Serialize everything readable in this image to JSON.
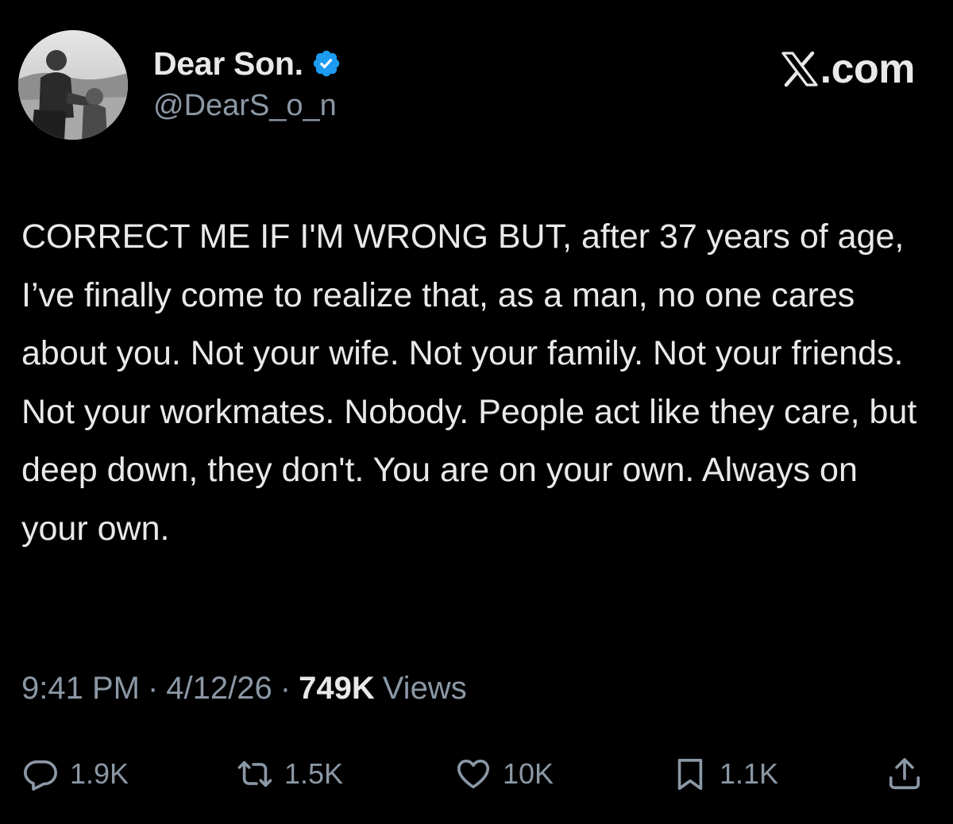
{
  "author": {
    "display_name": "Dear Son.",
    "handle": "@DearS_o_n",
    "verified": true,
    "avatar_icon": "avatar-photo"
  },
  "brand": {
    "logo_icon": "x-logo-icon",
    "text": ".com"
  },
  "tweet": {
    "text": "CORRECT ME IF I'M WRONG BUT, after 37 years of age, I’ve finally come to realize that, as a man, no one cares about you. Not your wife. Not your family. Not your friends. Not your workmates. Nobody. People act like they care, but deep down, they don't. You are on your own. Always on your own."
  },
  "meta": {
    "time": "9:41 PM",
    "date": "4/12/26",
    "separator": "·",
    "views_count": "749K",
    "views_label": "Views"
  },
  "actions": {
    "reply": {
      "icon": "reply-icon",
      "count": "1.9K"
    },
    "repost": {
      "icon": "repost-icon",
      "count": "1.5K"
    },
    "like": {
      "icon": "heart-icon",
      "count": "10K"
    },
    "bookmark": {
      "icon": "bookmark-icon",
      "count": "1.1K"
    },
    "share": {
      "icon": "share-icon"
    }
  },
  "colors": {
    "background": "#000000",
    "text_primary": "#e7e9ea",
    "text_secondary": "#8b98a5",
    "verified_badge": "#1d9bf0"
  }
}
